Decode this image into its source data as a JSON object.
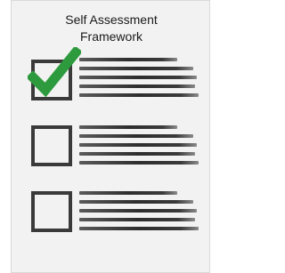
{
  "title": {
    "line1": "Self Assessment",
    "line2": "Framework"
  },
  "checklist": {
    "items": [
      {
        "checked": true
      },
      {
        "checked": false
      },
      {
        "checked": false
      }
    ]
  },
  "colors": {
    "check_mark": "#2e9a3e",
    "checkbox_border": "#3a3a3a",
    "card_background": "#f2f2f2"
  },
  "icons": {
    "check": "check-mark-icon"
  }
}
